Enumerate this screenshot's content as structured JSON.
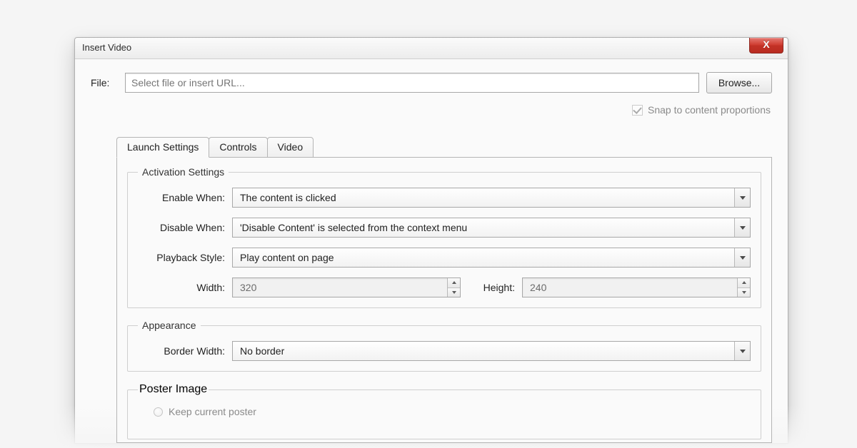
{
  "dialog": {
    "title": "Insert Video",
    "close_glyph": "X"
  },
  "file": {
    "label": "File:",
    "placeholder": "Select file or insert URL...",
    "browse": "Browse..."
  },
  "snap": {
    "label": "Snap to content proportions",
    "checked": true
  },
  "tabs": {
    "launch": "Launch Settings",
    "controls": "Controls",
    "video": "Video"
  },
  "activation": {
    "legend": "Activation Settings",
    "enable_label": "Enable When:",
    "enable_value": "The content is clicked",
    "disable_label": "Disable When:",
    "disable_value": "'Disable Content' is selected from the context menu",
    "playback_label": "Playback Style:",
    "playback_value": "Play content on page",
    "width_label": "Width:",
    "width_value": "320",
    "height_label": "Height:",
    "height_value": "240"
  },
  "appearance": {
    "legend": "Appearance",
    "border_label": "Border Width:",
    "border_value": "No border"
  },
  "poster": {
    "legend": "Poster Image",
    "keep_current": "Keep current poster"
  }
}
